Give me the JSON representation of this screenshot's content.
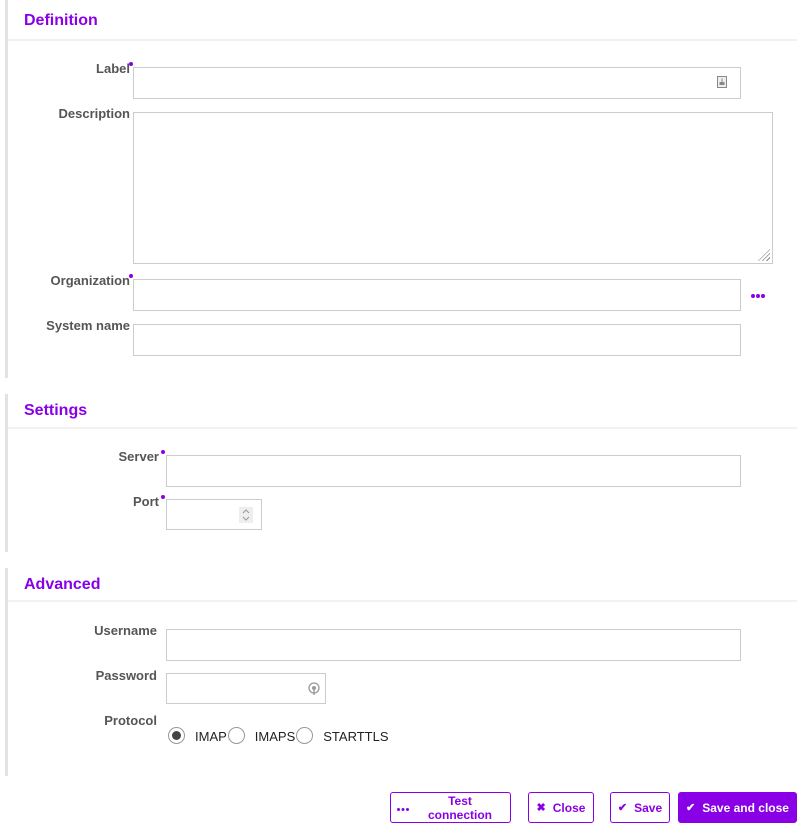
{
  "sections": {
    "definition": {
      "title": "Definition",
      "fields": {
        "label": {
          "label": "Label",
          "required": true,
          "value": ""
        },
        "description": {
          "label": "Description",
          "required": false,
          "value": ""
        },
        "organization": {
          "label": "Organization",
          "required": true,
          "value": "",
          "picker_icon": "ellipsis-icon"
        },
        "system_name": {
          "label": "System name",
          "required": false,
          "value": ""
        }
      }
    },
    "settings": {
      "title": "Settings",
      "fields": {
        "server": {
          "label": "Server",
          "required": true,
          "value": ""
        },
        "port": {
          "label": "Port",
          "required": true,
          "value": ""
        }
      }
    },
    "advanced": {
      "title": "Advanced",
      "fields": {
        "username": {
          "label": "Username",
          "required": false,
          "value": ""
        },
        "password": {
          "label": "Password",
          "required": false,
          "value": ""
        },
        "protocol": {
          "label": "Protocol",
          "selected": "IMAP",
          "options": [
            "IMAP",
            "IMAPS",
            "STARTTLS"
          ]
        }
      }
    }
  },
  "footer": {
    "test_connection": {
      "label": "Test connection",
      "icon": "ellipsis-icon"
    },
    "close": {
      "label": "Close",
      "icon": "x-icon"
    },
    "save": {
      "label": "Save",
      "icon": "check-icon"
    },
    "save_and_close": {
      "label": "Save and close",
      "icon": "check-icon"
    }
  },
  "colors": {
    "accent": "#8a00e6",
    "border": "#cccccc",
    "section_rule": "#e2e2e2"
  }
}
